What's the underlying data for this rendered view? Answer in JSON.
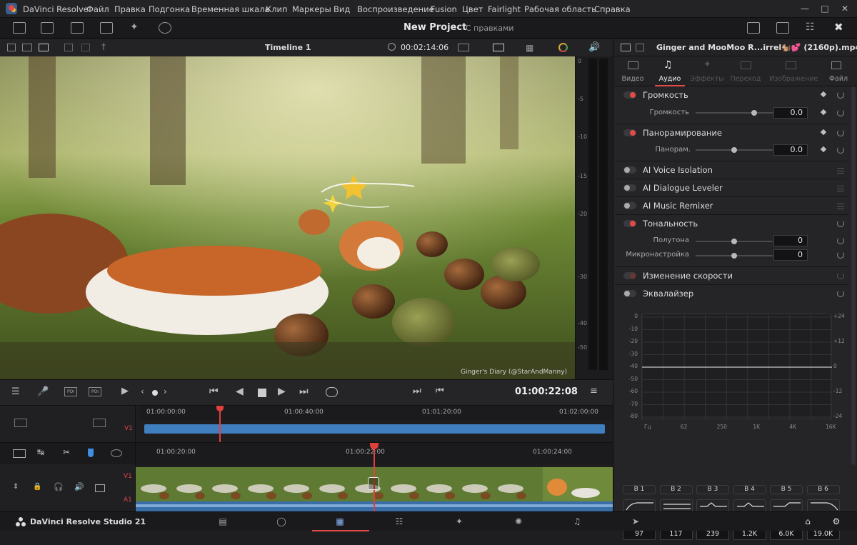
{
  "app": {
    "name": "DaVinci Resolve",
    "menu": [
      "Файл",
      "Правка",
      "Подгонка",
      "Временная шкала",
      "Клип",
      "Маркеры",
      "Вид",
      "Воспроизведение",
      "Fusion",
      "Цвет",
      "Fairlight",
      "Рабочая область",
      "Справка"
    ]
  },
  "header": {
    "project_title": "New Project",
    "project_status": "С правками"
  },
  "viewer": {
    "timeline_name": "Timeline 1",
    "timecode_top": "00:02:14:06",
    "watermark": "Ginger's Diary (@StarAndManny)",
    "playhead_timecode": "01:00:22:08"
  },
  "meter": {
    "scale": [
      "0",
      "-5",
      "-10",
      "-15",
      "-20",
      "-30",
      "-40",
      "-50"
    ]
  },
  "timeline_upper": {
    "track": "V1",
    "ticks": [
      "01:00:00:00",
      "01:00:40:00",
      "01:01:20:00",
      "01:02:00:00"
    ]
  },
  "timeline_lower": {
    "tracks": [
      "V1",
      "A1"
    ],
    "ticks": [
      "01:00:20:00",
      "01:00:22:00",
      "01:00:24:00"
    ]
  },
  "inspector": {
    "clip_name": "Ginger and MooMoo R...irrel🐿️💕 (2160p).mp4",
    "tabs": [
      "Видео",
      "Аудио",
      "Эффекты",
      "Переход",
      "Изображение",
      "Файл"
    ],
    "active_tab": "Аудио",
    "volume": {
      "title": "Громкость",
      "param": "Громкость",
      "value": "0.0",
      "level": 0.78
    },
    "pan": {
      "title": "Панорамирование",
      "param": "Панорам.",
      "value": "0.0",
      "level": 0.5
    },
    "ai_voice": "AI Voice Isolation",
    "ai_dialogue": "AI Dialogue Leveler",
    "ai_music": "AI Music Remixer",
    "pitch": {
      "title": "Тональность",
      "p1": "Полутона",
      "v1": "0",
      "p2": "Микронастройка",
      "v2": "0",
      "level": 0.5
    },
    "speed": "Изменение скорости",
    "eq": {
      "title": "Эквалайзер",
      "y_left": [
        "0",
        "-10",
        "-20",
        "-30",
        "-40",
        "-50",
        "-60",
        "-70",
        "-80"
      ],
      "y_right": [
        "+24",
        "+12",
        "0",
        "-12",
        "-24"
      ],
      "x_labels": [
        "Гц",
        "62",
        "250",
        "1K",
        "4K",
        "16K"
      ],
      "bands": [
        {
          "label": "B 1",
          "freq": "97"
        },
        {
          "label": "B 2",
          "freq": "117"
        },
        {
          "label": "B 3",
          "freq": "239"
        },
        {
          "label": "B 4",
          "freq": "1.2K"
        },
        {
          "label": "B 5",
          "freq": "6.0K"
        },
        {
          "label": "B 6",
          "freq": "19.0K"
        }
      ]
    }
  },
  "footer": {
    "product": "DaVinci Resolve Studio 21"
  },
  "colors": {
    "accent": "#e24b45",
    "clip_blue": "#3f7fc0",
    "playhead": "#e0403c"
  }
}
